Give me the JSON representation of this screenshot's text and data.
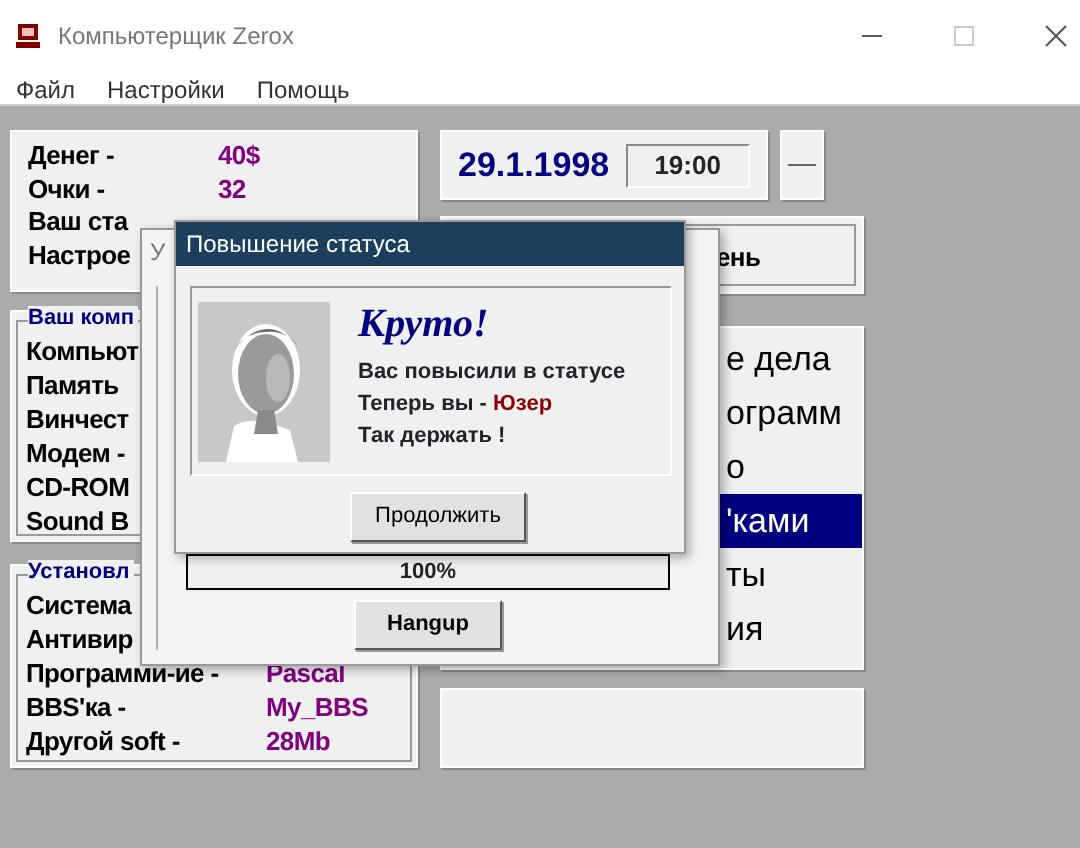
{
  "window": {
    "title": "Компьютерщик Zerox"
  },
  "menu": [
    "Файл",
    "Настройки",
    "Помощь"
  ],
  "stats": [
    {
      "label": "Денег -",
      "value": "40$"
    },
    {
      "label": "Очки -",
      "value": "32"
    },
    {
      "label": "Ваш ста"
    },
    {
      "label": "Настрое"
    }
  ],
  "date": "29.1.1998",
  "time": "19:00",
  "status_panel": {
    "text": "ень"
  },
  "computer": {
    "title": "Ваш комп",
    "lines": [
      {
        "label": "Компьют"
      },
      {
        "label": "Память"
      },
      {
        "label": "Винчест"
      },
      {
        "label": "Модем -"
      },
      {
        "label": "CD-ROM"
      },
      {
        "label": "Sound B"
      }
    ]
  },
  "software": {
    "title": "Установл",
    "lines": [
      {
        "label": "Система"
      },
      {
        "label": "Антивир"
      },
      {
        "label": "Программи-ие -",
        "value": "Pascal"
      },
      {
        "label": "BBS'ка -",
        "value": "My_BBS"
      },
      {
        "label": "Другой soft -",
        "value": "28Mb"
      }
    ]
  },
  "actions": [
    {
      "label": "е дела",
      "selected": false
    },
    {
      "label": "ограмм",
      "selected": false
    },
    {
      "label": "о",
      "selected": false
    },
    {
      "label": "'ками",
      "selected": true
    },
    {
      "label": "ты",
      "selected": false
    },
    {
      "label": "ия",
      "selected": false
    }
  ],
  "back_dialog": {
    "title": "У",
    "progress": {
      "reading": "100%"
    },
    "button": "Hangup"
  },
  "dialog": {
    "title": "Повышение статуса",
    "heading": "Круто!",
    "lines": [
      {
        "text": "Вас повысили в статусе"
      },
      {
        "text": "Теперь вы - ",
        "rank": "Юзер"
      },
      {
        "text": "Так держать !"
      }
    ],
    "button": "Продолжить"
  }
}
